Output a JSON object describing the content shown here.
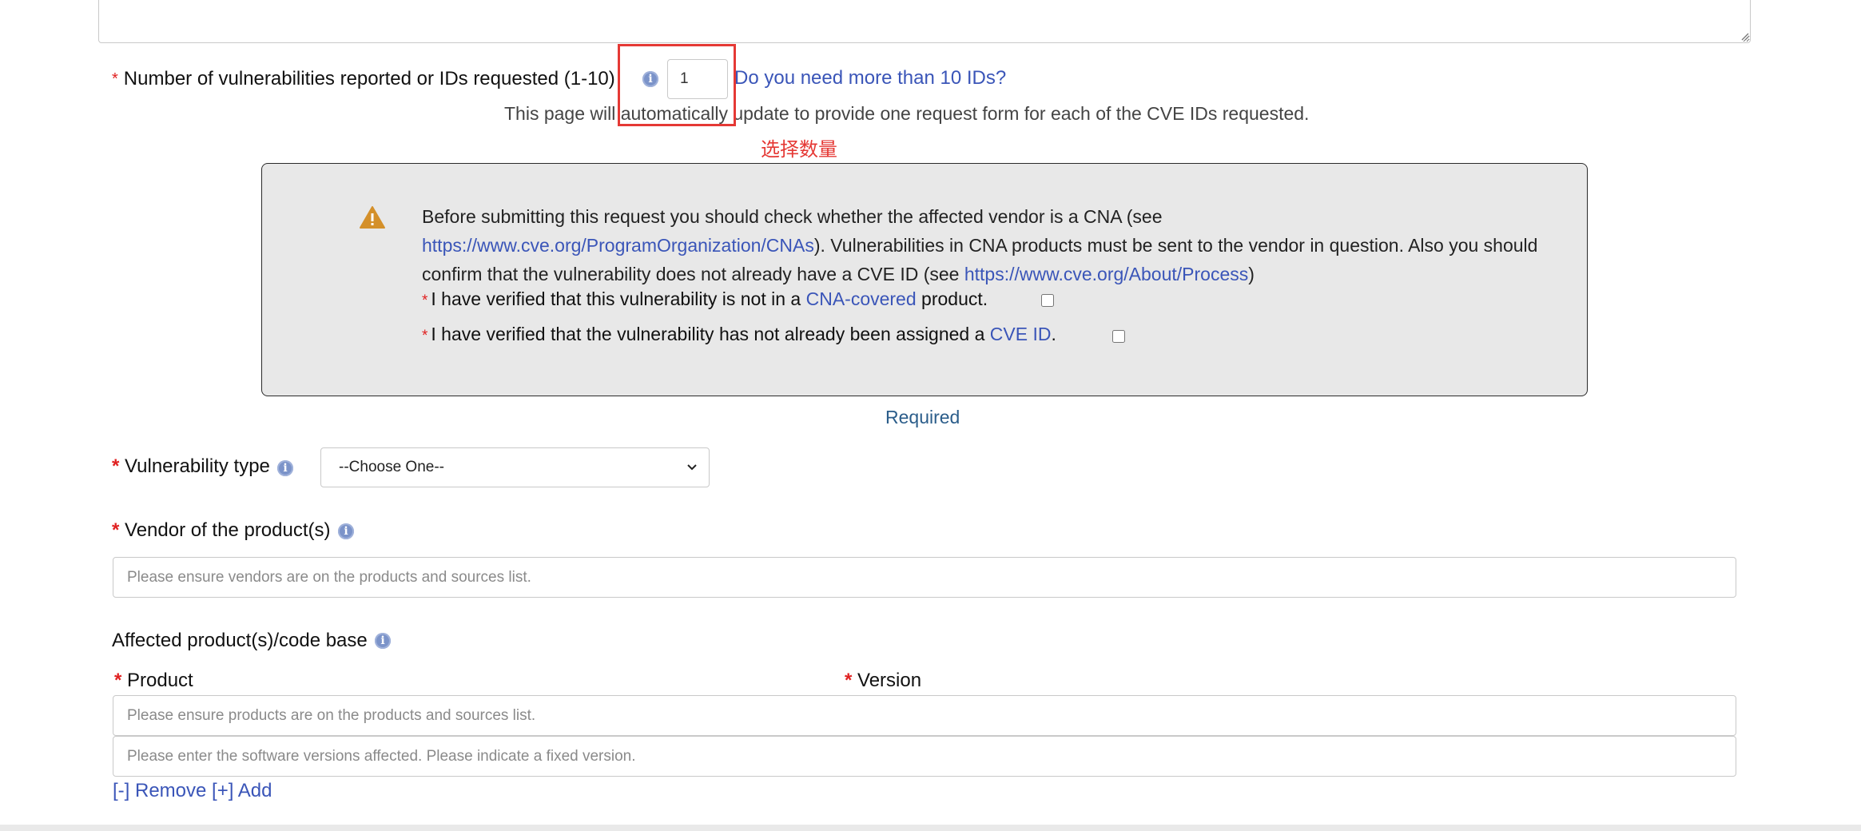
{
  "top_textarea": {
    "value": ""
  },
  "count_row": {
    "required_mark": "*",
    "label": "Number of vulnerabilities reported or IDs requested (1-10)",
    "info_icon": "info-icon",
    "value": "1",
    "more_link": "Do you need more than 10 IDs?",
    "help_text": "This page will automatically update to provide one request form for each of the CVE IDs requested."
  },
  "annotation": {
    "text": "选择数量",
    "color": "#e53935"
  },
  "warning_box": {
    "icon": "warning-triangle-icon",
    "text_before_link1": "Before submitting this request you should check whether the affected vendor is a CNA (see",
    "link1": "https://www.cve.org/ProgramOrganization/CNAs",
    "text_after_link1": "). Vulnerabilities in CNA products must be sent to the vendor in question. Also you should confirm that the vulnerability does not already have a CVE ID (see",
    "link2": "https://www.cve.org/About/Process",
    "text_after_link2": ")",
    "check1": {
      "required_mark": "*",
      "text_before": "I have verified that this vulnerability is not in a",
      "link": "CNA-covered",
      "text_after": "product.",
      "checked": false
    },
    "check2": {
      "required_mark": "*",
      "text_before": "I have verified that the vulnerability has not already been assigned a",
      "link": "CVE ID",
      "text_after": ".",
      "checked": false
    }
  },
  "required_link": "Required",
  "vuln_type": {
    "required_mark": "*",
    "label": "Vulnerability type",
    "info_icon": "info-icon",
    "selected": "--Choose One--"
  },
  "vendor": {
    "required_mark": "*",
    "label": "Vendor of the product(s)",
    "info_icon": "info-icon",
    "placeholder": "Please ensure vendors are on the products and sources list."
  },
  "affected": {
    "label": "Affected product(s)/code base",
    "info_icon": "info-icon",
    "product_required_mark": "*",
    "product_label": "Product",
    "version_required_mark": "*",
    "version_label": "Version",
    "product_placeholder": "Please ensure products are on the products and sources list.",
    "version_placeholder": "Please enter the software versions affected. Please indicate a fixed version.",
    "remove_link": "[-] Remove",
    "add_link": "[+] Add"
  },
  "colors": {
    "link": "#3a55b8",
    "required": "#e02020",
    "warning_bg": "#e8e8e8",
    "warning_icon": "#d4902a",
    "annotation_box": "#e53935"
  }
}
